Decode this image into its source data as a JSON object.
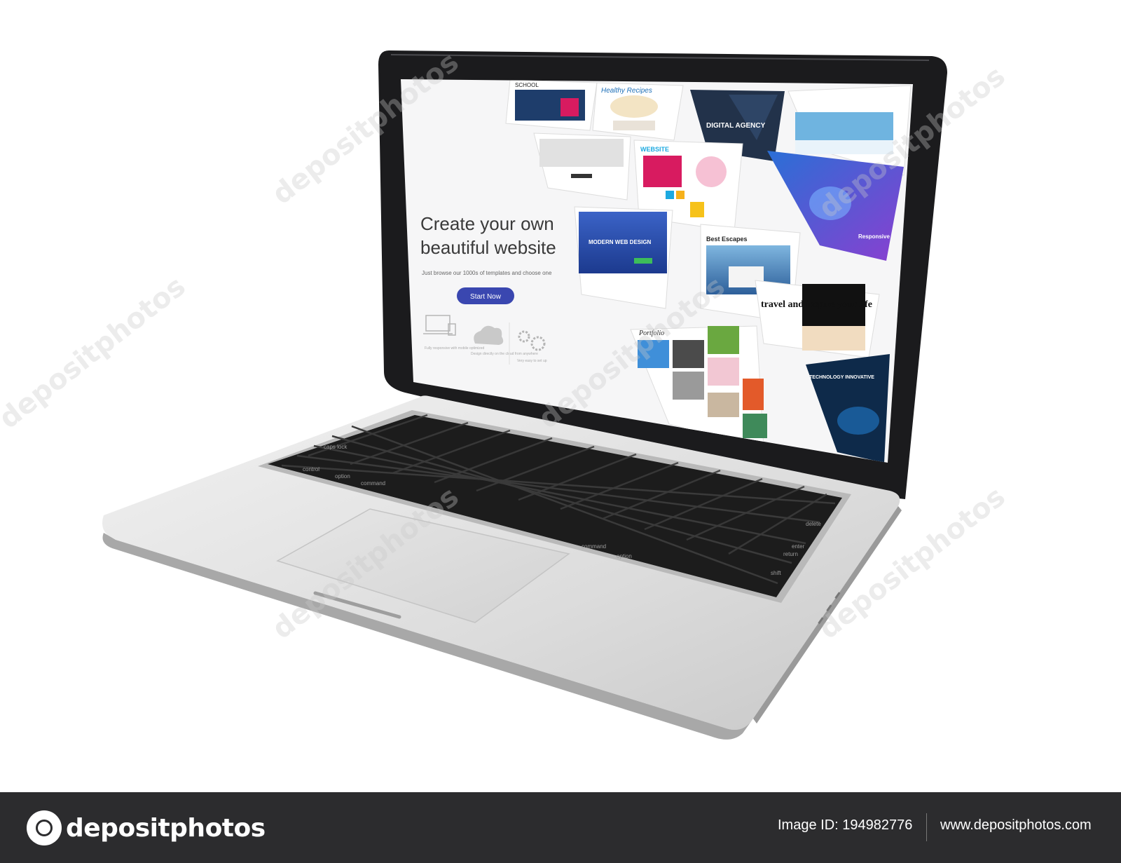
{
  "screen": {
    "headline_line1": "Create your own",
    "headline_line2": "beautiful website",
    "subtitle": "Just browse our 1000s of templates and choose one",
    "cta_label": "Start Now",
    "feature1": "Fully responsive with mobile optimized",
    "feature2": "Design directly on the cloud from anywhere",
    "feature3": "Very easy to set up",
    "tiles": {
      "school": "SCHOOL",
      "recipes": "Healthy Recipes",
      "agency": "DIGITAL AGENCY",
      "website": "WEBSITE",
      "modern": "MODERN WEB DESIGN",
      "escapes": "Best Escapes",
      "travel": "travel and inspire your life",
      "portfolio": "Portfolio",
      "technology": "TECHNOLOGY INNOVATIVE",
      "responsive": "Responsive"
    }
  },
  "keyboard": {
    "delete": "delete",
    "enter": "enter",
    "return": "return",
    "shift": "shift",
    "command": "command",
    "option": "option",
    "control": "control",
    "caps": "caps lock"
  },
  "watermark": "depositphotos",
  "footer": {
    "brand": "depositphotos",
    "image_id": "Image ID: 194982776",
    "site": "www.depositphotos.com"
  },
  "colors": {
    "footer_bg": "#2c2c2e",
    "cta": "#3a47b0"
  }
}
